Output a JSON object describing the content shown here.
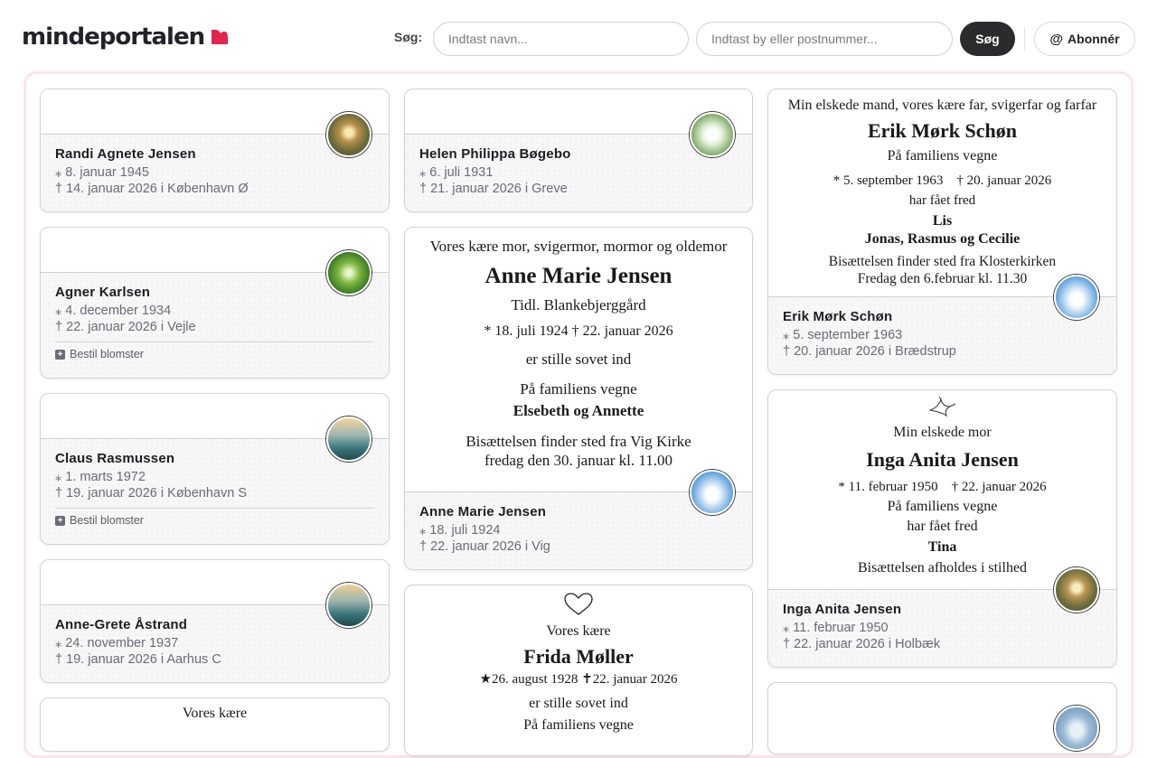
{
  "header": {
    "logo_text": "mindeportalen",
    "search_label": "Søg:",
    "name_placeholder": "Indtast navn...",
    "city_placeholder": "Indtast by eller postnummer...",
    "search_button": "Søg",
    "subscribe_button": "Abonnér"
  },
  "cards": [
    {
      "name": "Randi Agnete Jensen",
      "born": "⁎ 8. januar 1945",
      "died": "† 14. januar 2026 i København Ø",
      "avatar": "flower-photo"
    },
    {
      "name": "Agner Karlsen",
      "born": "⁎ 4. december 1934",
      "died": "† 22. januar 2026 i Vejle",
      "flowers": "Bestil blomster",
      "avatar": "leaf-photo"
    },
    {
      "name": "Claus Rasmussen",
      "born": "⁎ 1. marts 1972",
      "died": "† 19. januar 2026 i København S",
      "flowers": "Bestil blomster",
      "avatar": "landscape-photo"
    },
    {
      "name": "Anne-Grete Åstrand",
      "born": "⁎ 24. november 1937",
      "died": "† 19. januar 2026 i Aarhus C",
      "avatar": "landscape-photo"
    },
    {
      "name": "Helen Philippa Bøgebo",
      "born": "⁎ 6. juli 1931",
      "died": "† 21. januar 2026 i Greve",
      "avatar": "flower-photo"
    },
    {
      "name": "Anne Marie Jensen",
      "born": "⁎ 18. juli 1924",
      "died": "† 22. januar 2026 i Vig",
      "avatar": "cloud-photo"
    },
    {
      "name": "Erik Mørk Schøn",
      "born": "⁎ 5. september 1963",
      "died": "† 20. januar 2026 i Brædstrup",
      "avatar": "cloud-photo"
    },
    {
      "name": "Inga Anita Jensen",
      "born": "⁎ 11. februar 1950",
      "died": "† 22. januar 2026 i Holbæk",
      "avatar": "flower-photo"
    }
  ],
  "notices": {
    "anne_marie": [
      "Vores kære mor, svigermor, mormor og oldemor",
      "Anne Marie Jensen",
      "Tidl. Blankebjerggård",
      "* 18. juli 1924 † 22. januar 2026",
      "er stille sovet ind",
      "På familiens vegne",
      "Elsebeth og Annette",
      "Bisættelsen finder sted fra Vig Kirke",
      "fredag den 30. januar kl. 11.00"
    ],
    "erik": [
      "Min elskede mand, vores kære far, svigerfar og farfar",
      "Erik Mørk Schøn",
      "På familiens vegne",
      "* 5. september 1963    † 20. januar 2026",
      "har fået fred",
      "Lis",
      "Jonas, Rasmus og Cecilie",
      "Bisættelsen finder sted fra Klosterkirken",
      "Fredag den 6.februar kl. 11.30"
    ],
    "inga": [
      "Min elskede mor",
      "Inga Anita Jensen",
      "* 11. februar 1950    † 22. januar 2026",
      "På familiens vegne",
      "har fået fred",
      "Tina",
      "Bisættelsen afholdes i stilhed"
    ],
    "frida": [
      "Vores kære",
      "Frida Møller",
      "★26. august 1928    ✝22. januar 2026",
      "er stille sovet ind",
      "På familiens vegne"
    ],
    "bottom_left": [
      "Vores kære"
    ]
  },
  "colors": {
    "brand": "#e0284f",
    "dark_button": "#2b2b2e",
    "frame_border": "#fde4ec"
  }
}
